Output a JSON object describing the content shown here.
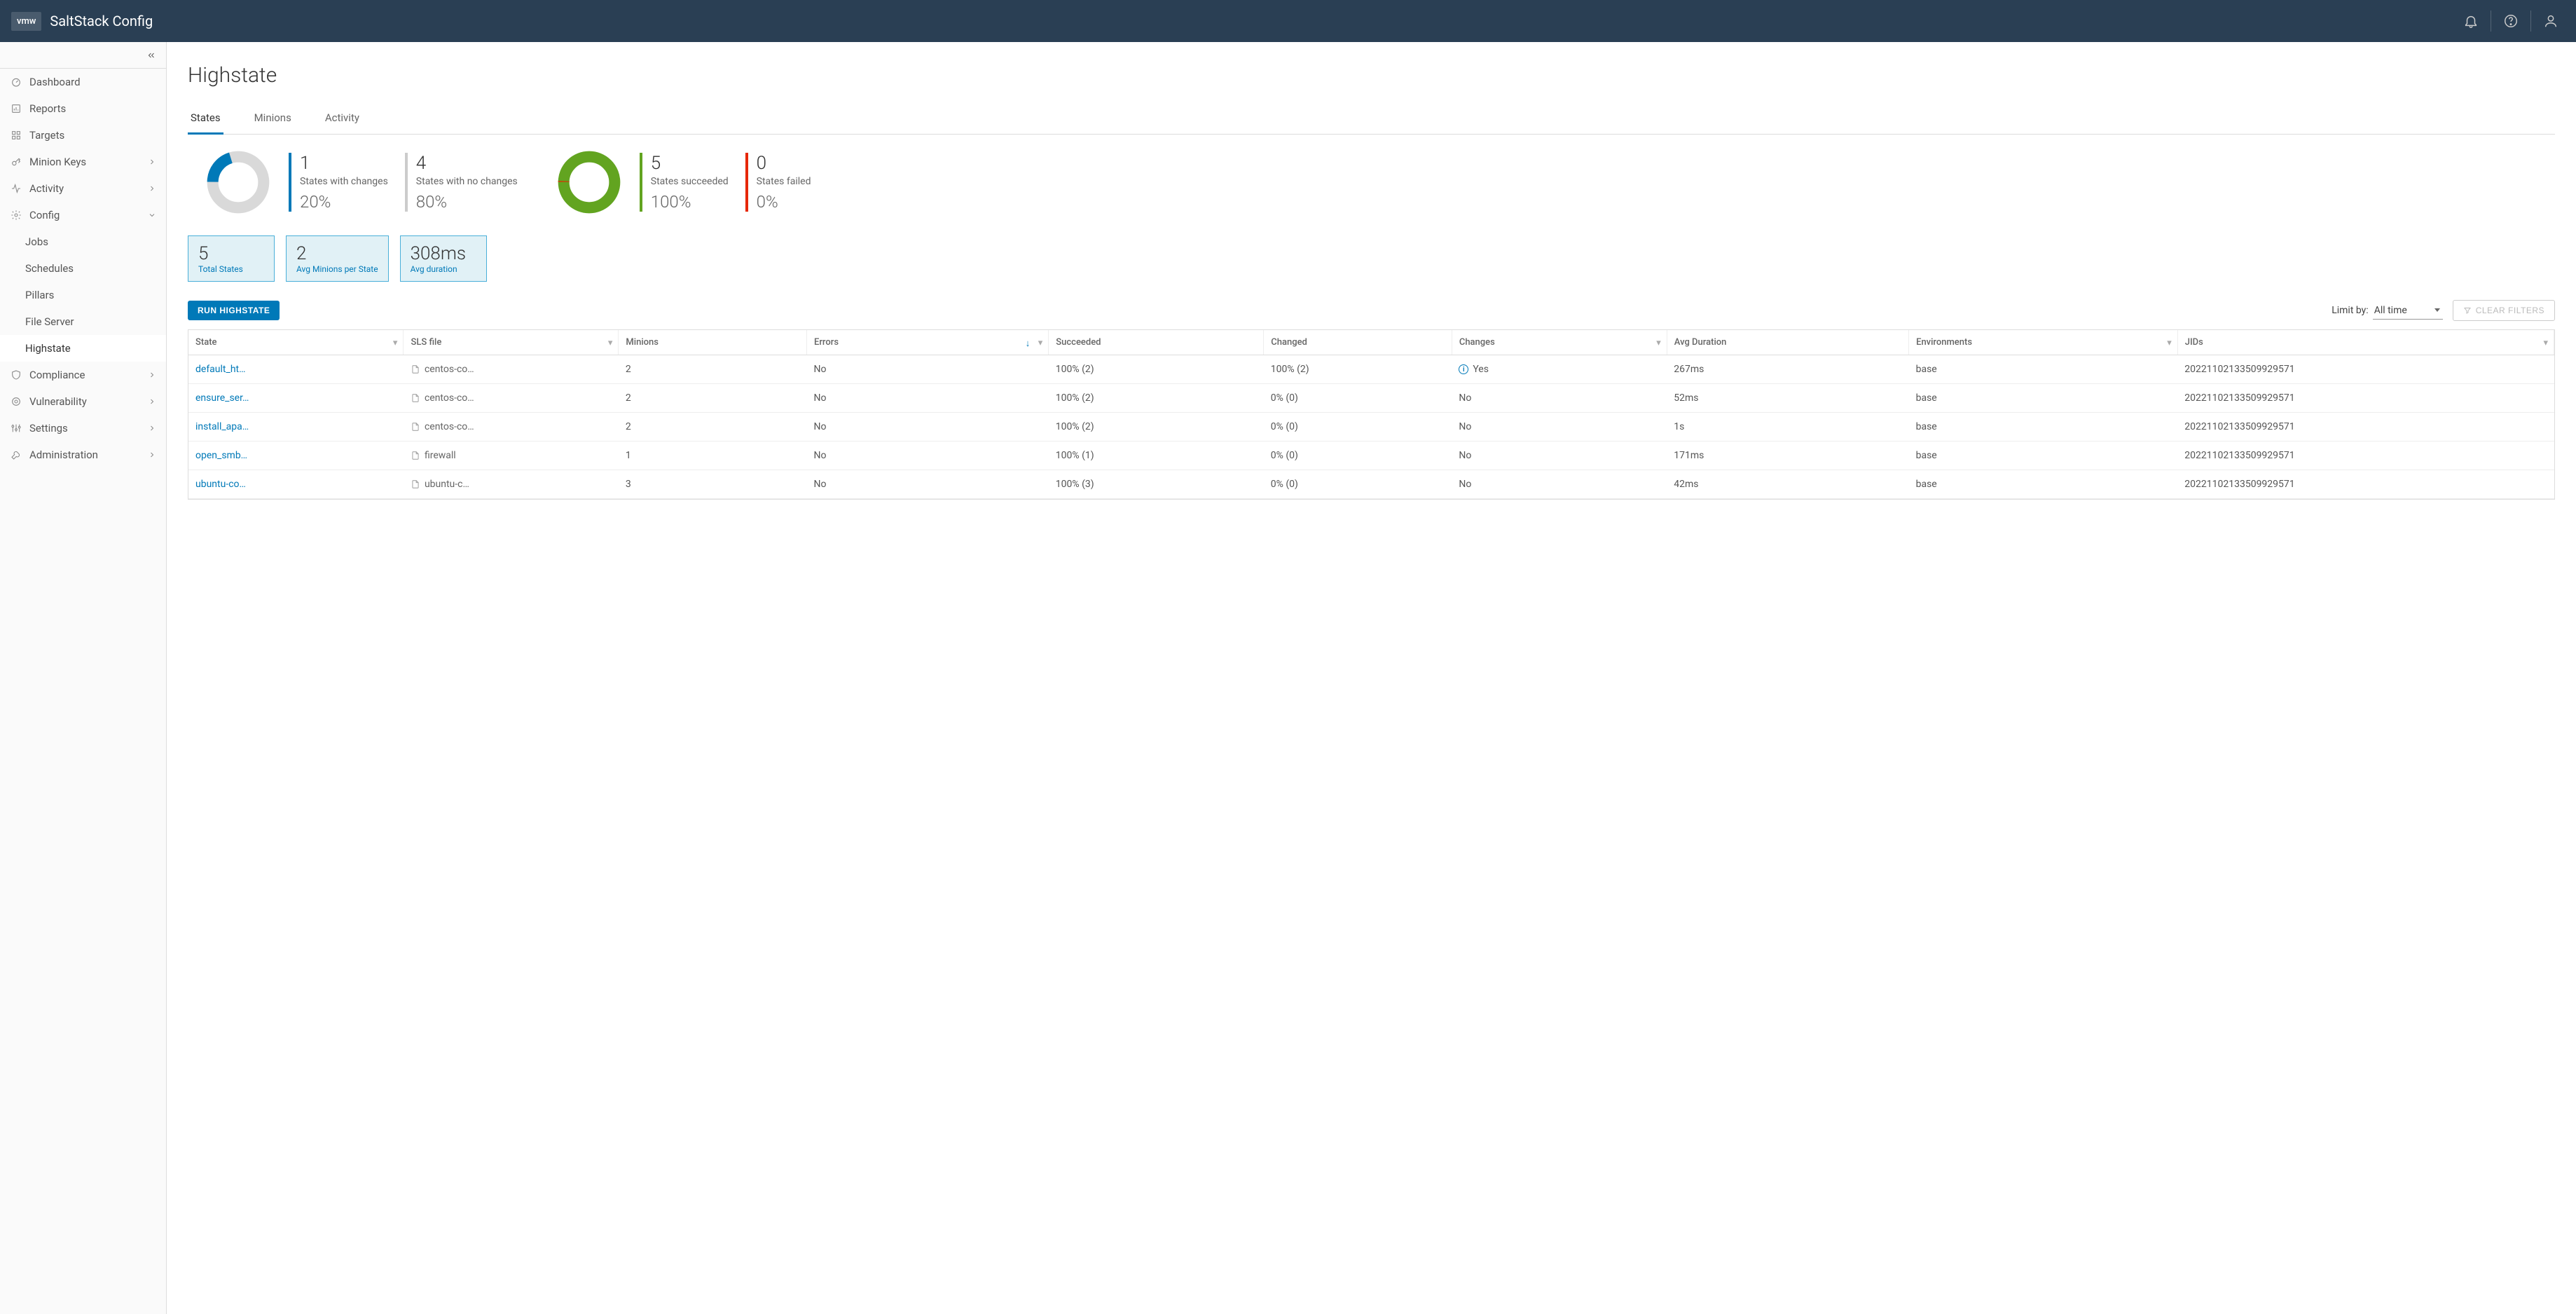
{
  "header": {
    "logo": "vmw",
    "title": "SaltStack Config"
  },
  "sidebar": {
    "items": [
      {
        "icon": "dashboard",
        "label": "Dashboard",
        "expandable": false
      },
      {
        "icon": "reports",
        "label": "Reports",
        "expandable": false
      },
      {
        "icon": "targets",
        "label": "Targets",
        "expandable": false
      },
      {
        "icon": "minionkeys",
        "label": "Minion Keys",
        "expandable": true
      },
      {
        "icon": "activity",
        "label": "Activity",
        "expandable": true
      },
      {
        "icon": "config",
        "label": "Config",
        "expandable": true,
        "expanded": true,
        "children": [
          {
            "label": "Jobs"
          },
          {
            "label": "Schedules"
          },
          {
            "label": "Pillars"
          },
          {
            "label": "File Server"
          },
          {
            "label": "Highstate",
            "active": true
          }
        ]
      },
      {
        "icon": "compliance",
        "label": "Compliance",
        "expandable": true
      },
      {
        "icon": "vulnerability",
        "label": "Vulnerability",
        "expandable": true
      },
      {
        "icon": "settings",
        "label": "Settings",
        "expandable": true
      },
      {
        "icon": "administration",
        "label": "Administration",
        "expandable": true
      }
    ]
  },
  "page": {
    "title": "Highstate"
  },
  "tabs": [
    {
      "label": "States",
      "active": true
    },
    {
      "label": "Minions"
    },
    {
      "label": "Activity"
    }
  ],
  "chart_data": [
    {
      "type": "pie",
      "title": "States change ratio",
      "series": [
        {
          "name": "States with changes",
          "value": 1,
          "pct": 20,
          "color": "#0079b8"
        },
        {
          "name": "States with no changes",
          "value": 4,
          "pct": 80,
          "color": "#ccc"
        }
      ]
    },
    {
      "type": "pie",
      "title": "States success ratio",
      "series": [
        {
          "name": "States succeeded",
          "value": 5,
          "pct": 100,
          "color": "#62a420"
        },
        {
          "name": "States failed",
          "value": 0,
          "pct": 0,
          "color": "#e62700"
        }
      ]
    }
  ],
  "stats": {
    "changes": {
      "value": "1",
      "label": "States with changes",
      "pct": "20%"
    },
    "nochanges": {
      "value": "4",
      "label": "States with no changes",
      "pct": "80%"
    },
    "succeeded": {
      "value": "5",
      "label": "States succeeded",
      "pct": "100%"
    },
    "failed": {
      "value": "0",
      "label": "States failed",
      "pct": "0%"
    }
  },
  "tiles": [
    {
      "value": "5",
      "label": "Total States"
    },
    {
      "value": "2",
      "label": "Avg Minions per State"
    },
    {
      "value": "308ms",
      "label": "Avg duration"
    }
  ],
  "actions": {
    "run": "RUN HIGHSTATE",
    "limit_label": "Limit by:",
    "limit_value": "All time",
    "clear": "CLEAR FILTERS"
  },
  "table": {
    "columns": [
      {
        "label": "State",
        "filter": true
      },
      {
        "label": "SLS file",
        "filter": true
      },
      {
        "label": "Minions"
      },
      {
        "label": "Errors",
        "filter": true,
        "sort": "asc"
      },
      {
        "label": "Succeeded"
      },
      {
        "label": "Changed"
      },
      {
        "label": "Changes",
        "filter": true
      },
      {
        "label": "Avg Duration"
      },
      {
        "label": "Environments",
        "filter": true
      },
      {
        "label": "JIDs",
        "filter": true
      }
    ],
    "rows": [
      {
        "state": "default_ht…",
        "sls": "centos-co…",
        "minions": "2",
        "errors": "No",
        "succeeded": "100% (2)",
        "changed": "100% (2)",
        "changes": "Yes",
        "changes_info": true,
        "duration": "267ms",
        "env": "base",
        "jid": "20221102133509929571"
      },
      {
        "state": "ensure_ser…",
        "sls": "centos-co…",
        "minions": "2",
        "errors": "No",
        "succeeded": "100% (2)",
        "changed": "0% (0)",
        "changes": "No",
        "duration": "52ms",
        "env": "base",
        "jid": "20221102133509929571"
      },
      {
        "state": "install_apa…",
        "sls": "centos-co…",
        "minions": "2",
        "errors": "No",
        "succeeded": "100% (2)",
        "changed": "0% (0)",
        "changes": "No",
        "duration": "1s",
        "env": "base",
        "jid": "20221102133509929571"
      },
      {
        "state": "open_smb…",
        "sls": "firewall",
        "minions": "1",
        "errors": "No",
        "succeeded": "100% (1)",
        "changed": "0% (0)",
        "changes": "No",
        "duration": "171ms",
        "env": "base",
        "jid": "20221102133509929571"
      },
      {
        "state": "ubuntu-co…",
        "sls": "ubuntu-c…",
        "minions": "3",
        "errors": "No",
        "succeeded": "100% (3)",
        "changed": "0% (0)",
        "changes": "No",
        "duration": "42ms",
        "env": "base",
        "jid": "20221102133509929571"
      }
    ]
  }
}
